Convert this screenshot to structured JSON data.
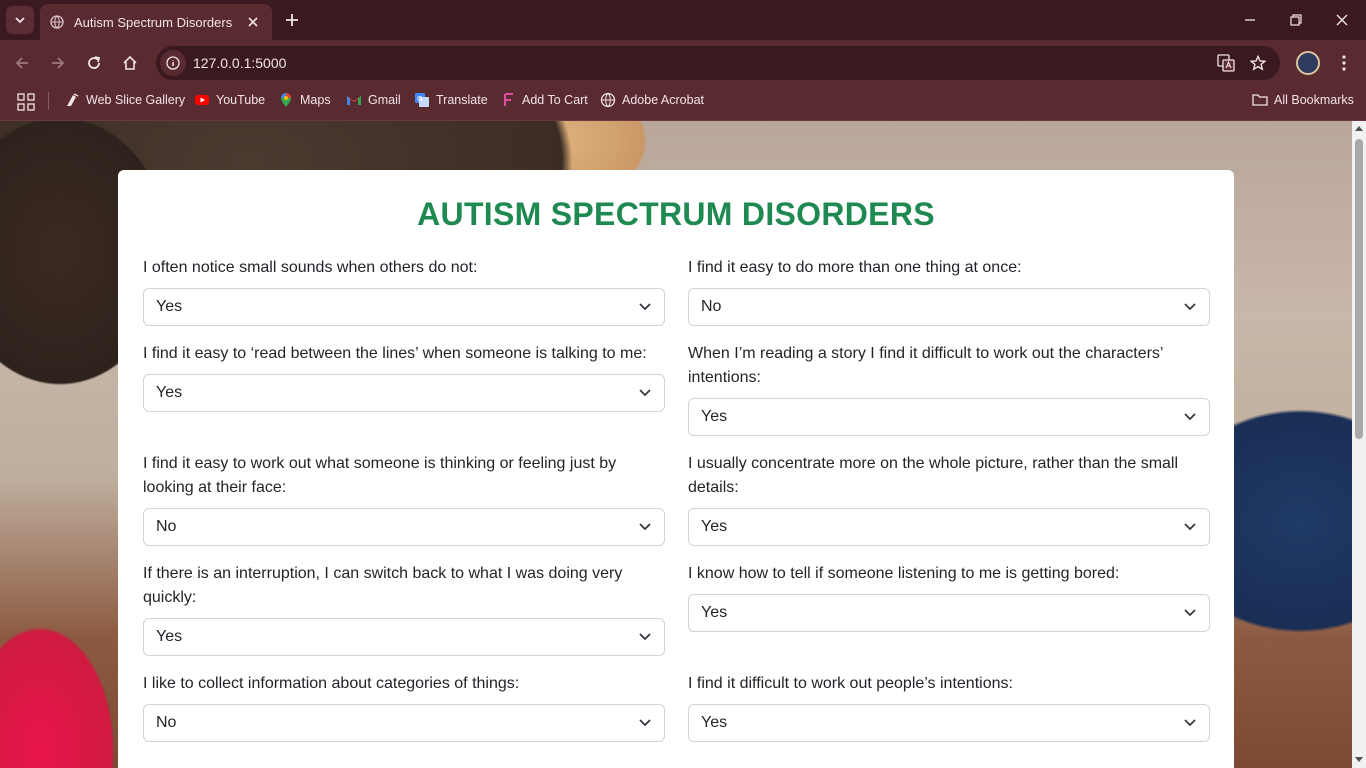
{
  "browser": {
    "tab_title": "Autism Spectrum Disorders",
    "url": "127.0.0.1:5000",
    "bookmarks": [
      {
        "label": "Web Slice Gallery",
        "icon": "web-slice-icon"
      },
      {
        "label": "YouTube",
        "icon": "youtube-icon"
      },
      {
        "label": "Maps",
        "icon": "maps-icon"
      },
      {
        "label": "Gmail",
        "icon": "gmail-icon"
      },
      {
        "label": "Translate",
        "icon": "translate-icon"
      },
      {
        "label": "Add To Cart",
        "icon": "add-to-cart-icon"
      },
      {
        "label": "Adobe Acrobat",
        "icon": "adobe-acrobat-icon"
      }
    ],
    "all_bookmarks_label": "All Bookmarks"
  },
  "page": {
    "title": "AUTISM SPECTRUM DISORDERS",
    "title_color": "#1e8a52",
    "questions": [
      {
        "label": "I often notice small sounds when others do not:",
        "value": "Yes"
      },
      {
        "label": "I find it easy to do more than one thing at once:",
        "value": "No"
      },
      {
        "label": "I find it easy to ‘read between the lines’ when someone is talking to me:",
        "value": "Yes"
      },
      {
        "label": "When I’m reading a story I find it difficult to work out the characters’ intentions:",
        "value": "Yes"
      },
      {
        "label": "I find it easy to work out what someone is thinking or feeling just by looking at their face:",
        "value": "No"
      },
      {
        "label": "I usually concentrate more on the whole picture, rather than the small details:",
        "value": "Yes"
      },
      {
        "label": "If there is an interruption, I can switch back to what I was doing very quickly:",
        "value": "Yes"
      },
      {
        "label": "I know how to tell if someone listening to me is getting bored:",
        "value": "Yes"
      },
      {
        "label": "I like to collect information about categories of things:",
        "value": "No"
      },
      {
        "label": "I find it difficult to work out people’s intentions:",
        "value": "Yes"
      }
    ]
  }
}
